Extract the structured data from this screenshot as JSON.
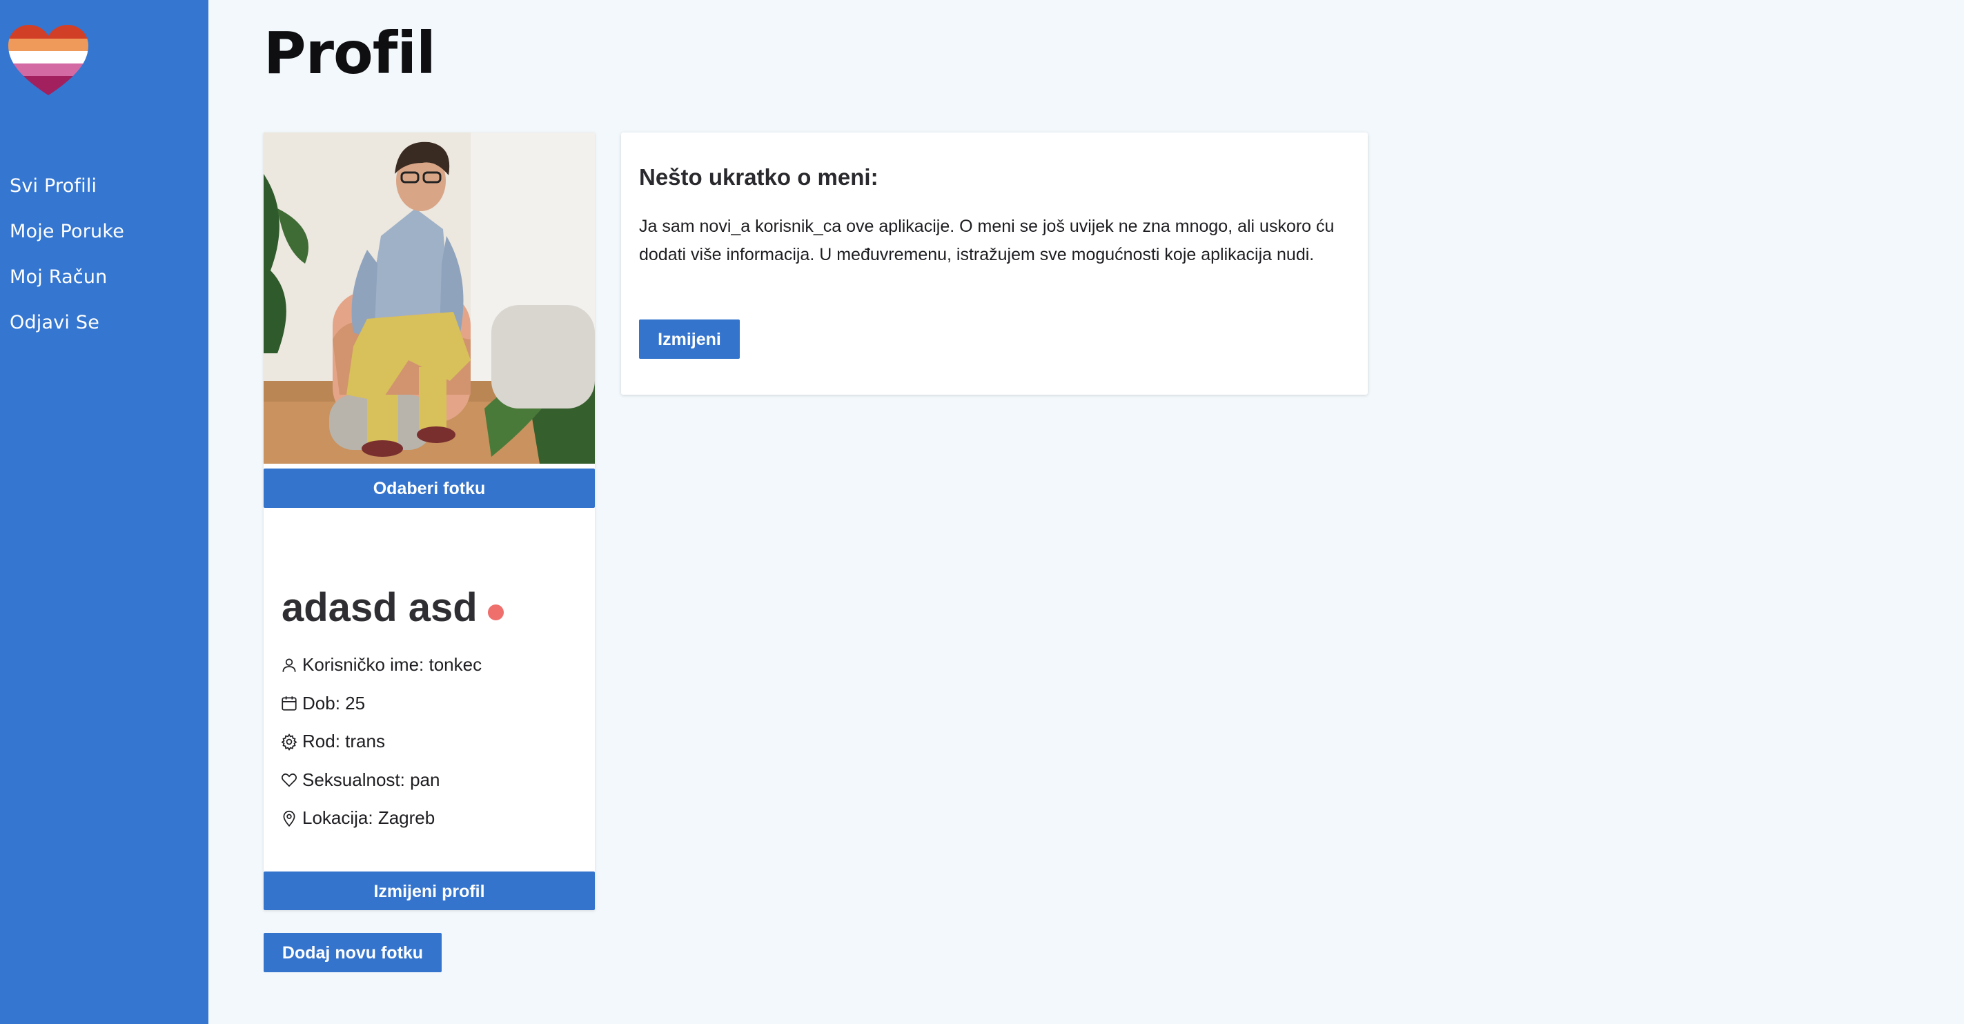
{
  "sidebar": {
    "logo_icon": "rainbow-heart-icon",
    "items": [
      {
        "label": "Svi Profili"
      },
      {
        "label": "Moje Poruke"
      },
      {
        "label": "Moj Račun"
      },
      {
        "label": "Odjavi Se"
      }
    ]
  },
  "page": {
    "title": "Profil"
  },
  "profile": {
    "photo_alt": "profile-photo",
    "pick_photo_label": "Odaberi fotku",
    "name": "adasd asd",
    "status_color": "#ee6f6c",
    "details": [
      {
        "icon": "user-icon",
        "text": "Korisničko ime: tonkec"
      },
      {
        "icon": "calendar-icon",
        "text": "Dob: 25"
      },
      {
        "icon": "gear-icon",
        "text": "Rod: trans"
      },
      {
        "icon": "heart-icon",
        "text": "Seksualnost: pan"
      },
      {
        "icon": "location-pin-icon",
        "text": "Lokacija: Zagreb"
      }
    ],
    "edit_profile_label": "Izmijeni profil",
    "add_photo_label": "Dodaj novu fotku"
  },
  "about": {
    "title": "Nešto ukratko o meni:",
    "text": "Ja sam novi_a korisnik_ca ove aplikacije. O meni se još uvijek ne zna mnogo, ali uskoro ću dodati više informacija. U međuvremenu, istražujem sve mogućnosti koje aplikacija nudi.",
    "edit_label": "Izmijeni"
  },
  "colors": {
    "sidebar": "#3476d0",
    "button": "#3474cc",
    "background": "#f2f8fb"
  }
}
